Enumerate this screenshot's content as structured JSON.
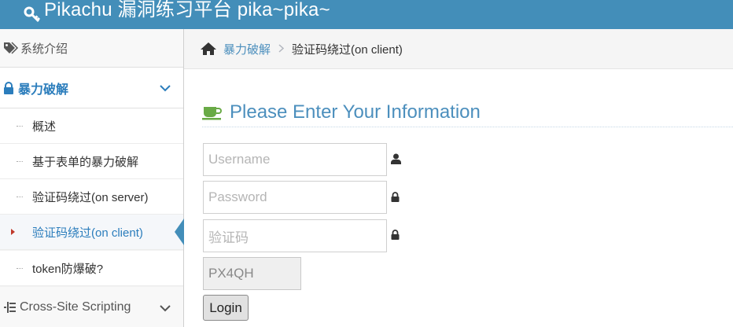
{
  "header": {
    "title": "Pikachu 漏洞练习平台 pika~pika~"
  },
  "sidebar": {
    "intro": "系统介绍",
    "bruteforce": "暴力破解",
    "sub_items": [
      "概述",
      "基于表单的暴力破解",
      "验证码绕过(on server)",
      "验证码绕过(on client)",
      "token防爆破?"
    ],
    "xss": "Cross-Site Scripting"
  },
  "breadcrumb": {
    "parent": "暴力破解",
    "current": "验证码绕过(on client)"
  },
  "main": {
    "heading": "Please Enter Your Information",
    "username_placeholder": "Username",
    "password_placeholder": "Password",
    "vcode_placeholder": "验证码",
    "vcode_value": "PX4QH",
    "login_label": "Login"
  },
  "colors": {
    "topbar": "#438eb9",
    "accent": "#2b7dbc",
    "link": "#4c8fbd"
  }
}
